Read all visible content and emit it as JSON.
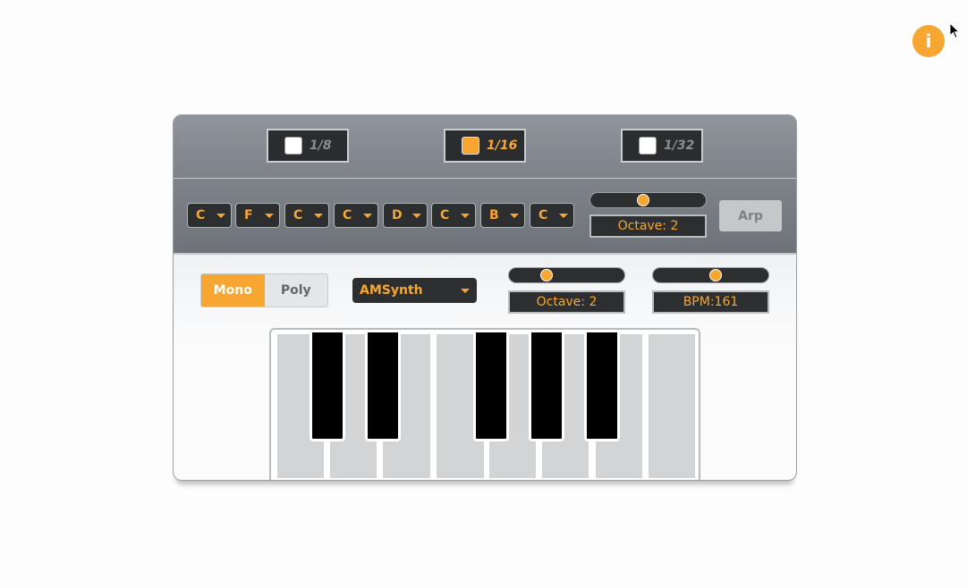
{
  "info_button": {
    "label": "i"
  },
  "subdivisions": [
    {
      "label": "1/8",
      "checked": false
    },
    {
      "label": "1/16",
      "checked": true
    },
    {
      "label": "1/32",
      "checked": false
    }
  ],
  "sequence_notes": [
    "C",
    "F",
    "C",
    "C",
    "D",
    "C",
    "B",
    "C"
  ],
  "arp": {
    "octave_display": "Octave: 2",
    "octave_slider_value": 0.45,
    "button_label": "Arp"
  },
  "mode": {
    "options": [
      "Mono",
      "Poly"
    ],
    "selected": "Mono"
  },
  "synth_type": {
    "selected": "AMSynth"
  },
  "main_octave": {
    "display": "Octave: 2",
    "slider_value": 0.3
  },
  "tempo": {
    "display": "BPM:161",
    "slider_value": 0.55
  },
  "keyboard": {
    "white_keys": 8,
    "black_keys": 5
  },
  "colors": {
    "accent": "#f7a731",
    "panel_dark": "#2c2e30",
    "key_white": "#d2d4d6",
    "key_black": "#000000"
  }
}
